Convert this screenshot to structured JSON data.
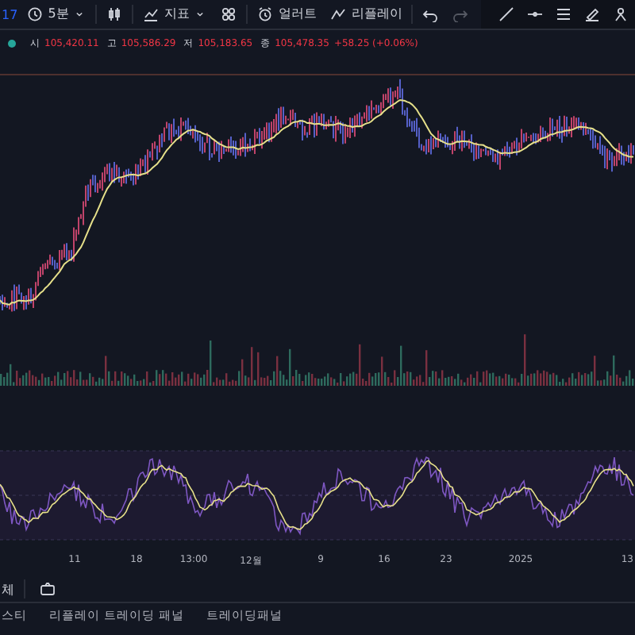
{
  "toolbar": {
    "items": [
      {
        "kind": "symbol",
        "label": "17"
      },
      {
        "kind": "interval",
        "label": "5분"
      },
      {
        "kind": "candles"
      },
      {
        "kind": "indicators",
        "label": "지표"
      },
      {
        "kind": "layouts"
      },
      {
        "kind": "alert",
        "label": "얼러트"
      },
      {
        "kind": "replay",
        "label": "리플레이"
      },
      {
        "kind": "undo",
        "disabled": false
      },
      {
        "kind": "redo",
        "disabled": true
      }
    ]
  },
  "legend": {
    "fields": [
      {
        "label": "시",
        "value": "105,420.11"
      },
      {
        "label": "고",
        "value": "105,586.29"
      },
      {
        "label": "저",
        "value": "105,183.65"
      },
      {
        "label": "종",
        "value": "105,478.35"
      }
    ],
    "change": "+58.25 (+0.06%)"
  },
  "x_axis": {
    "labels": [
      "11",
      "18",
      "13:00",
      "12월",
      "9",
      "16",
      "23",
      "2025",
      "13"
    ]
  },
  "bottom_bar": {
    "label": "체"
  },
  "bottom_tabs": [
    {
      "label": "스티",
      "selected": false
    },
    {
      "label": "리플레이 트레이딩 패널",
      "selected": false
    },
    {
      "label": "트레이딩패널",
      "selected": false
    }
  ]
}
